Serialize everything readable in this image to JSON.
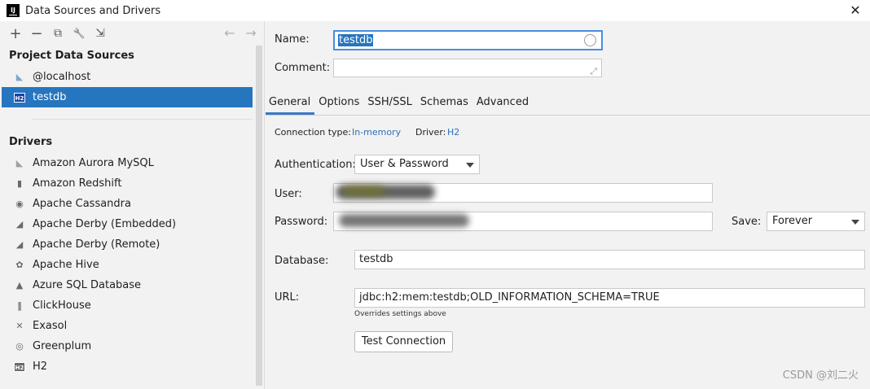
{
  "window": {
    "title": "Data Sources and Drivers",
    "app_icon_text": "IJ",
    "close_glyph": "✕"
  },
  "toolbar": {
    "add": "+",
    "remove": "−",
    "duplicate": "⧉",
    "properties": "🔧",
    "import": "⇲",
    "back": "←",
    "forward": "→"
  },
  "sidebar": {
    "project_header": "Project Data Sources",
    "project_items": [
      {
        "label": "@localhost",
        "icon": "mysql-dolphin-icon"
      },
      {
        "label": "testdb",
        "icon": "h2-icon",
        "badge": "H2"
      }
    ],
    "drivers_header": "Drivers",
    "drivers": [
      {
        "label": "Amazon Aurora MySQL",
        "icon": "mysql-dolphin-icon",
        "glyph": "◣"
      },
      {
        "label": "Amazon Redshift",
        "icon": "redshift-icon",
        "glyph": "▮"
      },
      {
        "label": "Apache Cassandra",
        "icon": "cassandra-eye-icon",
        "glyph": "◉"
      },
      {
        "label": "Apache Derby (Embedded)",
        "icon": "derby-hat-icon",
        "glyph": "◢"
      },
      {
        "label": "Apache Derby (Remote)",
        "icon": "derby-hat-icon",
        "glyph": "◢"
      },
      {
        "label": "Apache Hive",
        "icon": "hive-icon",
        "glyph": "✿"
      },
      {
        "label": "Azure SQL Database",
        "icon": "azure-icon",
        "glyph": "▲"
      },
      {
        "label": "ClickHouse",
        "icon": "clickhouse-icon",
        "glyph": "‖"
      },
      {
        "label": "Exasol",
        "icon": "exasol-icon",
        "glyph": "✕"
      },
      {
        "label": "Greenplum",
        "icon": "greenplum-icon",
        "glyph": "◎"
      },
      {
        "label": "H2",
        "icon": "h2-icon",
        "badge": "H2"
      }
    ]
  },
  "form": {
    "name_label": "Name:",
    "name_value": "testdb",
    "comment_label": "Comment:",
    "comment_value": "",
    "tabs": [
      "General",
      "Options",
      "SSH/SSL",
      "Schemas",
      "Advanced"
    ],
    "active_tab": "General",
    "connection_type_label": "Connection type:",
    "connection_type_value": "In-memory",
    "driver_label": "Driver:",
    "driver_value": "H2",
    "auth_label": "Authentication:",
    "auth_value": "User & Password",
    "user_label": "User:",
    "password_label": "Password:",
    "save_label": "Save:",
    "save_value": "Forever",
    "database_label": "Database:",
    "database_value": "testdb",
    "url_label": "URL:",
    "url_value": "jdbc:h2:mem:testdb;OLD_INFORMATION_SCHEMA=TRUE",
    "url_hint": "Overrides settings above",
    "test_button": "Test Connection"
  },
  "watermark": "CSDN @刘二火",
  "colors": {
    "selection": "#2675bf",
    "link": "#2f6fb8",
    "focus_border": "#4a8de0"
  }
}
